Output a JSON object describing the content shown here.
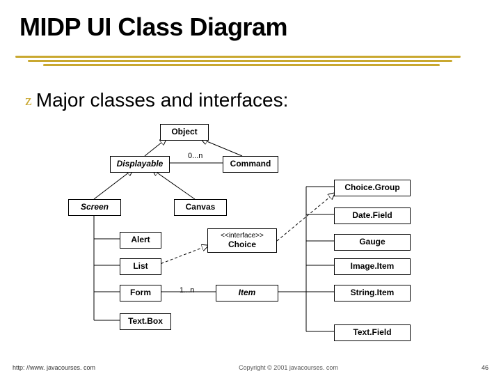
{
  "title": "MIDP UI Class Diagram",
  "bullet": "Major classes and interfaces:",
  "boxes": {
    "object": "Object",
    "displayable": "Displayable",
    "command": "Command",
    "screen": "Screen",
    "canvas": "Canvas",
    "alert": "Alert",
    "list": "List",
    "form": "Form",
    "textbox": "Text.Box",
    "choice_stereo": "<<interface>>",
    "choice": "Choice",
    "item": "Item",
    "choicegroup": "Choice.Group",
    "datefield": "Date.Field",
    "gauge": "Gauge",
    "imageitem": "Image.Item",
    "stringitem": "String.Item",
    "textfield": "Text.Field"
  },
  "labels": {
    "zero_n": "0...n",
    "one_n": "1...n"
  },
  "footer": {
    "url": "http: //www. javacourses. com",
    "copyright": "Copyright © 2001 javacourses. com",
    "page": "46"
  }
}
